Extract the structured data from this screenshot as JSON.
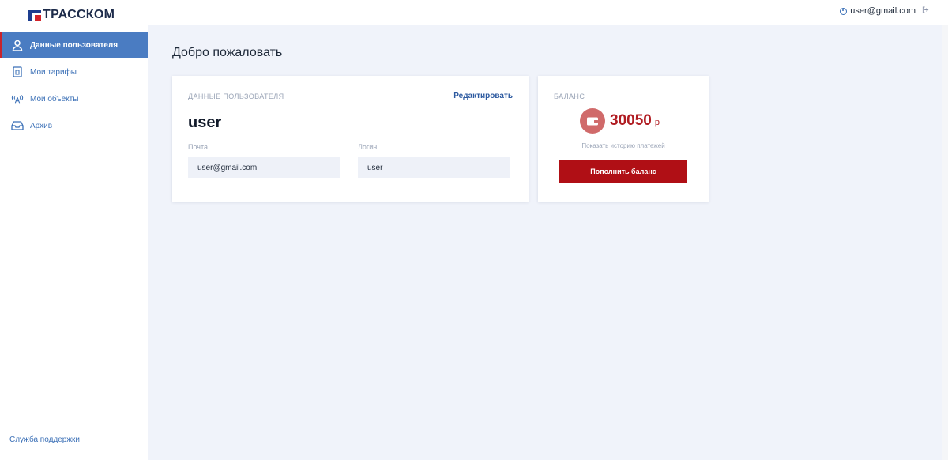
{
  "brand": {
    "name": "ТРАССКОМ"
  },
  "header": {
    "user_email": "user@gmail.com"
  },
  "sidebar": {
    "items": [
      {
        "label": "Данные пользователя",
        "icon": "user-icon"
      },
      {
        "label": "Мои тарифы",
        "icon": "document-icon"
      },
      {
        "label": "Мои объекты",
        "icon": "antenna-icon"
      },
      {
        "label": "Архив",
        "icon": "inbox-icon"
      }
    ],
    "support_label": "Служба поддержки"
  },
  "main": {
    "title": "Добро пожаловать"
  },
  "user_card": {
    "label": "ДАННЫЕ ПОЛЬЗОВАТЕЛЯ",
    "edit_label": "Редактировать",
    "username": "user",
    "email_label": "Почта",
    "email_value": "user@gmail.com",
    "login_label": "Логин",
    "login_value": "user"
  },
  "balance_card": {
    "label": "БАЛАНС",
    "amount": "30050",
    "currency": "р",
    "history_label": "Показать историю платежей",
    "topup_label": "Пополнить баланс"
  },
  "colors": {
    "accent_blue": "#4a7cc2",
    "brand_red": "#b00f15",
    "page_bg": "#f0f3fa"
  }
}
